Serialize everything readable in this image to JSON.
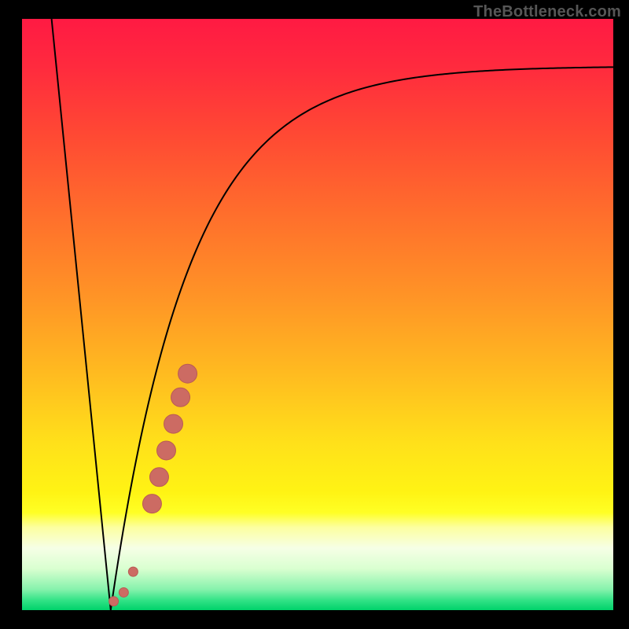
{
  "attribution": "TheBottleneck.com",
  "colors": {
    "gradient_stops": [
      {
        "offset": 0.0,
        "color": "#ff1a43"
      },
      {
        "offset": 0.08,
        "color": "#ff2a3e"
      },
      {
        "offset": 0.2,
        "color": "#ff4a33"
      },
      {
        "offset": 0.33,
        "color": "#ff6e2c"
      },
      {
        "offset": 0.47,
        "color": "#ff9426"
      },
      {
        "offset": 0.6,
        "color": "#ffbb20"
      },
      {
        "offset": 0.72,
        "color": "#ffe11a"
      },
      {
        "offset": 0.8,
        "color": "#fff314"
      },
      {
        "offset": 0.835,
        "color": "#ffff24"
      },
      {
        "offset": 0.86,
        "color": "#fcffa0"
      },
      {
        "offset": 0.895,
        "color": "#f6ffe6"
      },
      {
        "offset": 0.93,
        "color": "#d9ffd0"
      },
      {
        "offset": 0.965,
        "color": "#86f2ac"
      },
      {
        "offset": 0.983,
        "color": "#33e387"
      },
      {
        "offset": 1.0,
        "color": "#00d26a"
      }
    ],
    "curve": "#000000",
    "marker_fill": "#cc6b63",
    "marker_stroke": "#b95b54"
  },
  "chart_data": {
    "type": "line",
    "title": "",
    "xlabel": "",
    "ylabel": "",
    "xlim": [
      0,
      100
    ],
    "ylim": [
      0,
      100
    ],
    "curve_left": {
      "x0": 5,
      "y0": 100,
      "x1": 15,
      "y1": 0
    },
    "curve_right": {
      "x_start": 15,
      "x_end": 100,
      "y_start": 0,
      "y_asymptote": 92,
      "rate": 0.075
    },
    "series": [
      {
        "name": "markers",
        "points": [
          {
            "x": 15.5,
            "y": 1.5,
            "r": 6
          },
          {
            "x": 17.2,
            "y": 3.0,
            "r": 6
          },
          {
            "x": 18.8,
            "y": 6.5,
            "r": 6
          },
          {
            "x": 22.0,
            "y": 18.0,
            "r": 12
          },
          {
            "x": 23.2,
            "y": 22.5,
            "r": 12
          },
          {
            "x": 24.4,
            "y": 27.0,
            "r": 12
          },
          {
            "x": 25.6,
            "y": 31.5,
            "r": 12
          },
          {
            "x": 26.8,
            "y": 36.0,
            "r": 12
          },
          {
            "x": 28.0,
            "y": 40.0,
            "r": 12
          }
        ]
      }
    ]
  }
}
